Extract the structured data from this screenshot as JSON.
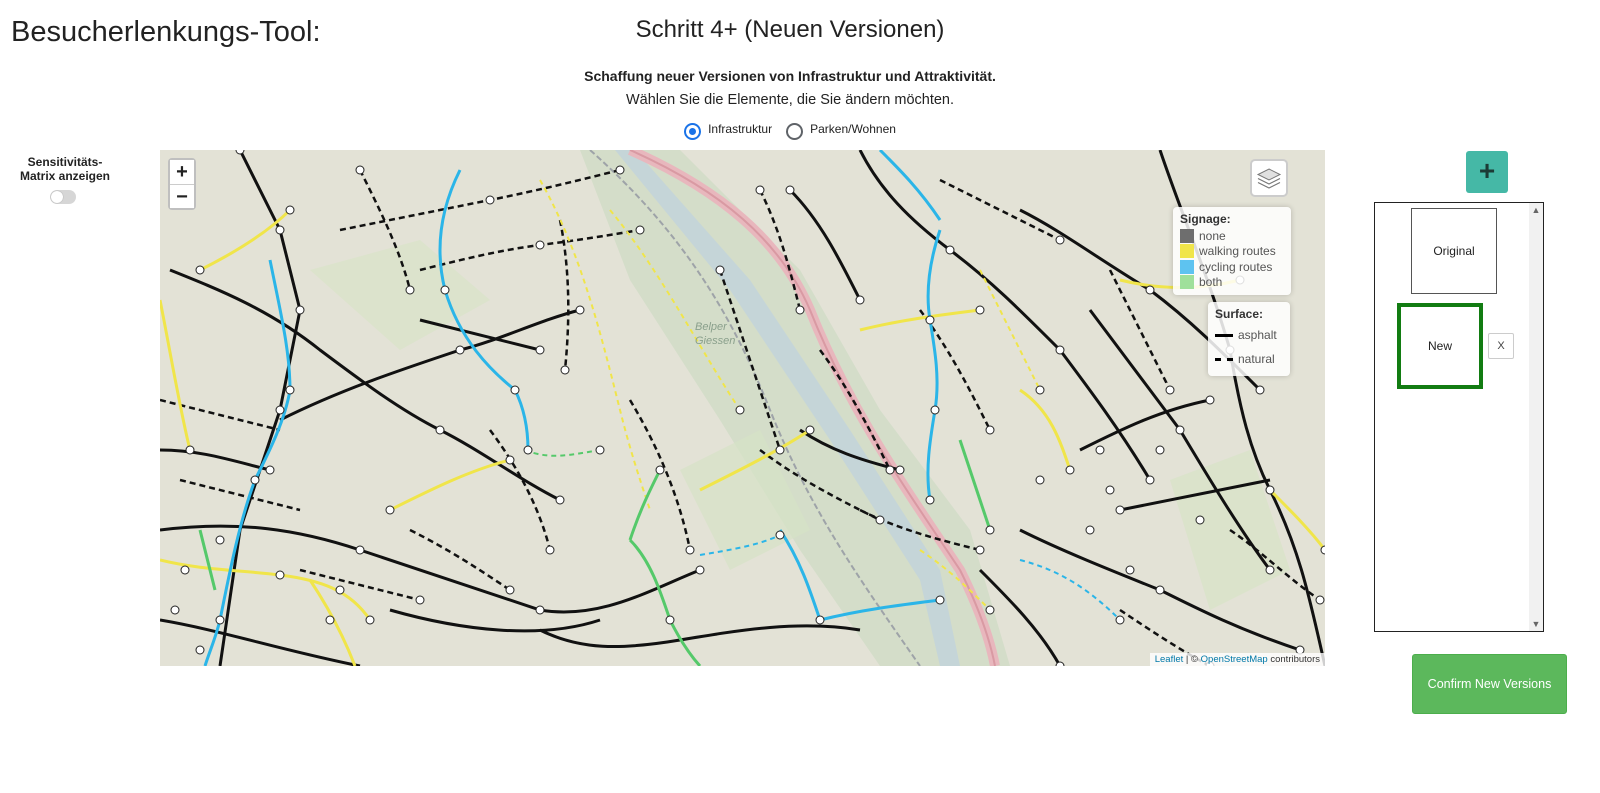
{
  "header": {
    "app_title": "Besucherlenkungs-Tool:",
    "step_title": "Schritt 4+ (Neuen Versionen)",
    "step_bold": "Schaffung neuer Versionen von Infrastruktur und Attraktivität.",
    "step_desc": "Wählen Sie die Elemente, die Sie ändern möchten."
  },
  "radio": {
    "options": [
      {
        "label": "Infrastruktur",
        "checked": true
      },
      {
        "label": "Parken/Wohnen",
        "checked": false
      }
    ]
  },
  "sensitivity": {
    "label": "Sensitivitäts-Matrix anzeigen",
    "enabled": false
  },
  "map": {
    "zoom_in": "+",
    "zoom_out": "−",
    "place_label_1": "Belper",
    "place_label_2": "Giessen",
    "signage": {
      "title": "Signage:",
      "items": [
        {
          "label": "none",
          "color": "#6e6e6e"
        },
        {
          "label": "walking routes",
          "color": "#f0e54a"
        },
        {
          "label": "cycling routes",
          "color": "#5ec3f0"
        },
        {
          "label": "both",
          "color": "#9fe09b"
        }
      ]
    },
    "surface": {
      "title": "Surface:",
      "items": [
        {
          "label": "asphalt",
          "style": "solid"
        },
        {
          "label": "natural",
          "style": "dashed"
        }
      ]
    },
    "attribution": {
      "leaflet": "Leaflet",
      "sep": " | © ",
      "osm": "OpenStreetMap",
      "contributors": " contributors"
    }
  },
  "versions": {
    "add_label": "+",
    "items": [
      {
        "label": "Original",
        "selected": false
      },
      {
        "label": "New",
        "selected": true
      }
    ],
    "remove_label": "X",
    "scroll_up": "▲",
    "scroll_down": "▼",
    "confirm_label": "Confirm New Versions"
  },
  "colors": {
    "accent": "#45b8a6",
    "confirm": "#5cb85c",
    "selected_border": "#127c12",
    "walking": "#f0e54a",
    "cycling": "#2bb5e8",
    "both": "#55c96a"
  }
}
